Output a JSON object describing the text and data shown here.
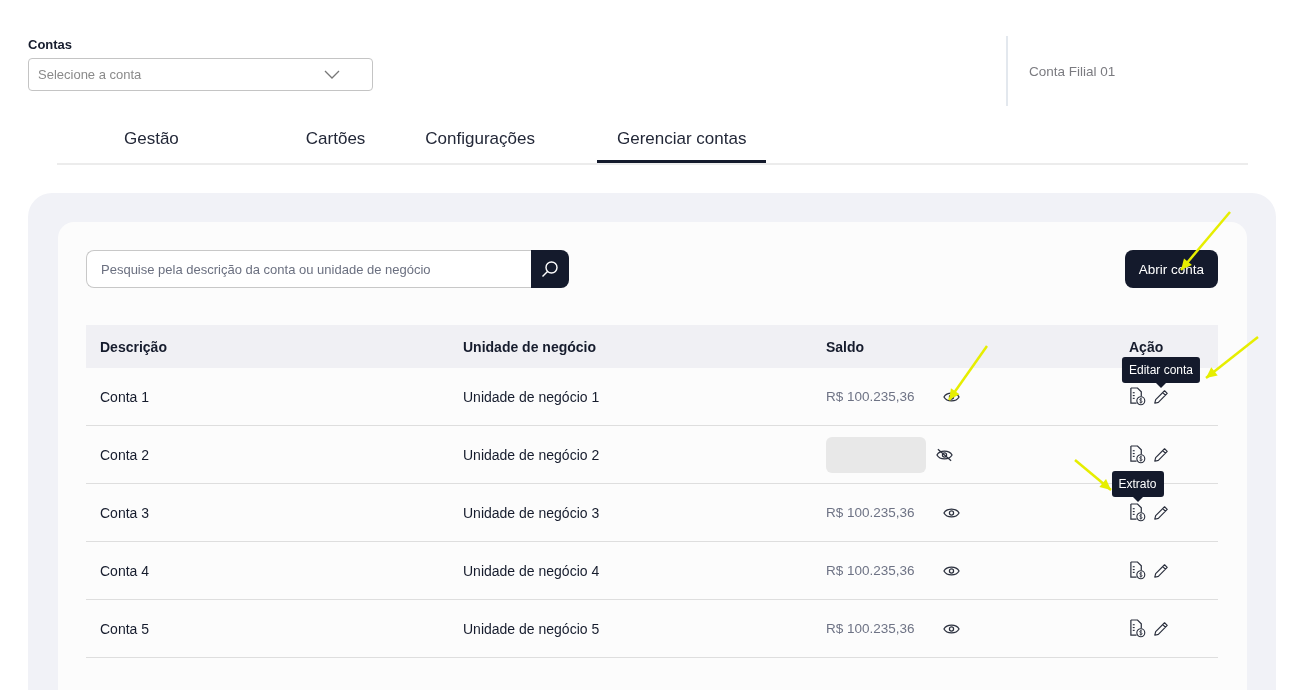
{
  "account_select": {
    "label": "Contas",
    "placeholder": "Selecione a conta"
  },
  "current_account": "Conta Filial 01",
  "tabs": [
    {
      "label": "Gestão",
      "selected": false
    },
    {
      "label": "Cartões",
      "selected": false
    },
    {
      "label": "Configurações",
      "selected": false
    },
    {
      "label": "Gerenciar contas",
      "selected": true
    }
  ],
  "search": {
    "placeholder": "Pesquise pela descrição da conta ou unidade de negócio"
  },
  "open_account_button": "Abrir conta",
  "table": {
    "columns": [
      "Descrição",
      "Unidade de negócio",
      "Saldo",
      "Ação"
    ],
    "rows": [
      {
        "description": "Conta 1",
        "business_unit": "Unidade de negócio 1",
        "balance": "R$ 100.235,36",
        "balance_visible": true,
        "tooltip": {
          "kind": "edit",
          "text": "Editar conta"
        }
      },
      {
        "description": "Conta 2",
        "business_unit": "Unidade de negócio 2",
        "balance_visible": false
      },
      {
        "description": "Conta 3",
        "business_unit": "Unidade de negócio 3",
        "balance": "R$ 100.235,36",
        "balance_visible": true,
        "tooltip": {
          "kind": "statement",
          "text": "Extrato"
        }
      },
      {
        "description": "Conta 4",
        "business_unit": "Unidade de negócio 4",
        "balance": "R$ 100.235,36",
        "balance_visible": true
      },
      {
        "description": "Conta 5",
        "business_unit": "Unidade de negócio 5",
        "balance": "R$ 100.235,36",
        "balance_visible": true
      }
    ]
  }
}
